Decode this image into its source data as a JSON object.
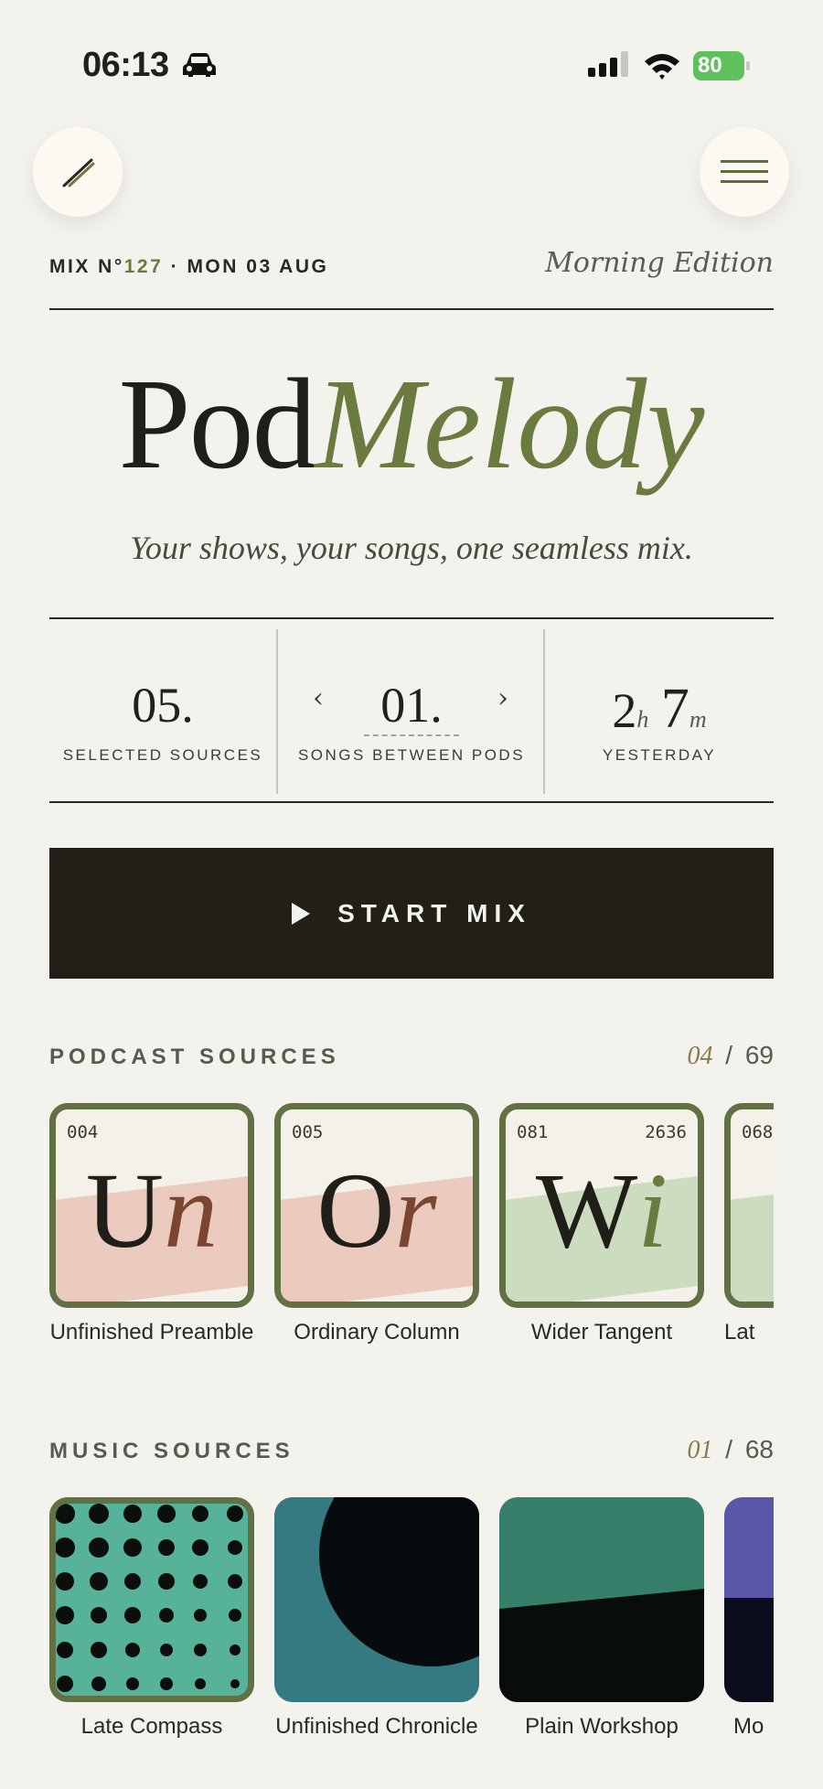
{
  "status": {
    "time": "06:13",
    "battery": "80"
  },
  "header": {
    "mix_prefix": "MIX N°",
    "mix_number": "127",
    "mix_date": " · MON 03 AUG",
    "edition": "Morning Edition"
  },
  "brand": {
    "word1": "Pod",
    "word2": "Melody",
    "tagline": "Your shows, your songs, one seamless mix."
  },
  "stats": {
    "sources_value": "05.",
    "sources_label": "SELECTED SOURCES",
    "songs_value": "01.",
    "songs_label": "SONGS BETWEEN PODS",
    "prev_arrow": "‹",
    "next_arrow": "›",
    "hours": "2",
    "hours_unit": "h",
    "minutes": "7",
    "minutes_unit": "m",
    "time_label": "YESTERDAY"
  },
  "start_button": {
    "label": "START MIX"
  },
  "podcasts": {
    "title": "PODCAST SOURCES",
    "selected": "04",
    "separator": "/",
    "total": "69",
    "items": [
      {
        "code": "004",
        "count": "",
        "mono_a": "U",
        "mono_b": "n",
        "name": "Unfinished Preamble",
        "fill": "#ebcbbd"
      },
      {
        "code": "005",
        "count": "",
        "mono_a": "O",
        "mono_b": "r",
        "name": "Ordinary Column",
        "fill": "#ebcbbd"
      },
      {
        "code": "081",
        "count": "2636",
        "mono_a": "W",
        "mono_b": "i",
        "name": "Wider Tangent",
        "fill": "#ccdcbe"
      },
      {
        "code": "068",
        "count": "",
        "mono_a": "",
        "mono_b": "",
        "name": "Lat",
        "fill": "#ccdcbe"
      }
    ]
  },
  "music": {
    "title": "MUSIC SOURCES",
    "selected": "01",
    "separator": "/",
    "total": "68",
    "items": [
      {
        "name": "Late Compass",
        "art": "dots"
      },
      {
        "name": "Unfinished Chronicle",
        "art": "moon"
      },
      {
        "name": "Plain Workshop",
        "art": "horizon"
      },
      {
        "name": "Mo",
        "art": "violet"
      }
    ]
  },
  "colors": {
    "background": "#f4f2ed",
    "accent_olive": "#6b7a3f",
    "dark": "#211f18",
    "battery_green": "#5fc05d"
  },
  "icons": {
    "pen": "pen-icon",
    "menu": "hamburger-menu-icon",
    "play": "play-icon"
  }
}
